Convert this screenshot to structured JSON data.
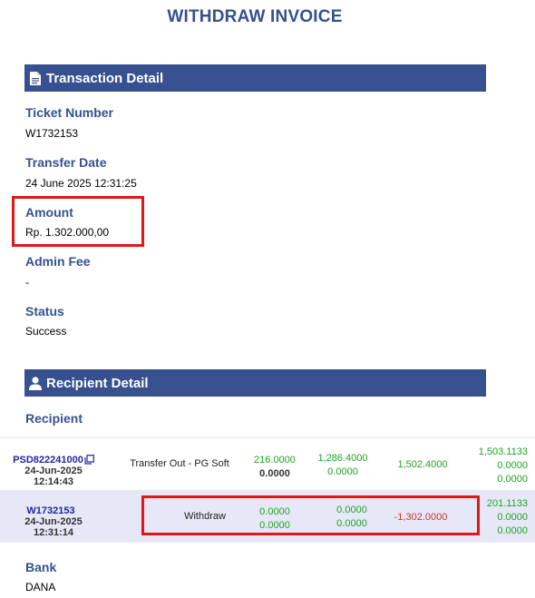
{
  "page_title": "WITHDRAW INVOICE",
  "transaction_section": {
    "title": "Transaction Detail",
    "ticket_label": "Ticket Number",
    "ticket_value": "W1732153",
    "date_label": "Transfer Date",
    "date_value": "24 June 2025 12:31:25",
    "amount_label": "Amount",
    "amount_value": "Rp. 1.302.000,00",
    "fee_label": "Admin Fee",
    "fee_value": "-",
    "status_label": "Status",
    "status_value": "Success"
  },
  "recipient_section": {
    "title": "Recipient Detail",
    "recipient_label": "Recipient",
    "rows": [
      {
        "ref": "PSD822241000",
        "date": "24-Jun-2025 12:14:43",
        "desc": "Transfer Out - PG Soft",
        "col1": [
          "216.0000",
          "0.0000"
        ],
        "col2": [
          "1,286.4000",
          "0.0000"
        ],
        "col3": "1,502.4000",
        "col4": [
          "1,503.1133",
          "0.0000",
          "0.0000"
        ]
      },
      {
        "ref": "W1732153",
        "date": "24-Jun-2025 12:31:14",
        "desc": "Withdraw",
        "col1": [
          "0.0000",
          "0.0000"
        ],
        "col2": [
          "0.0000",
          "0.0000"
        ],
        "col3": "-1,302.0000",
        "col4": [
          "201.1133",
          "0.0000",
          "0.0000"
        ]
      }
    ],
    "bank_label": "Bank",
    "bank_value": "DANA"
  },
  "colors": {
    "header_bar": "#37508f",
    "label_blue": "#35518f",
    "highlight_red": "#e01818",
    "positive_green": "#22a322",
    "negative_red": "#d23333",
    "alt_row": "#e6e8f7"
  },
  "icons": {
    "transaction": "document-icon",
    "recipient": "user-icon",
    "copy": "copy-icon"
  }
}
